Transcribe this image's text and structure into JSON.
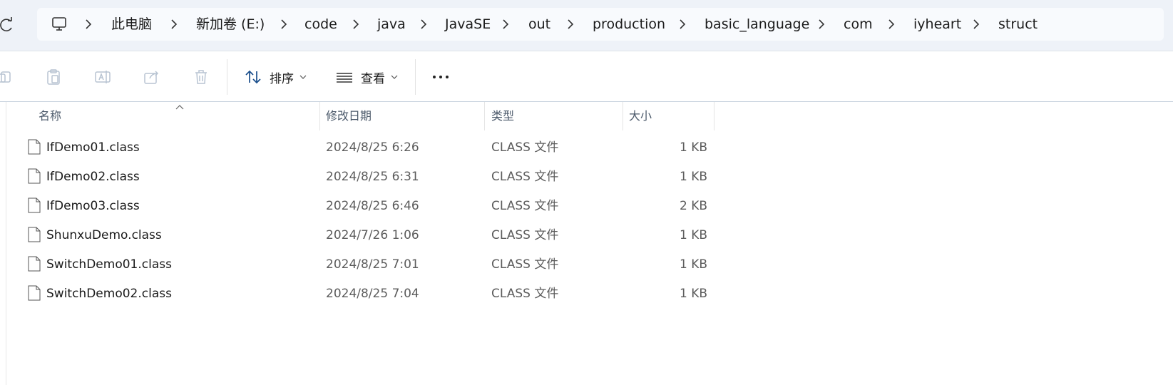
{
  "breadcrumbs": [
    "此电脑",
    "新加卷 (E:)",
    "code",
    "java",
    "JavaSE",
    "out",
    "production",
    "basic_language",
    "com",
    "iyheart",
    "struct"
  ],
  "toolbar": {
    "sort_label": "排序",
    "view_label": "查看"
  },
  "columns": {
    "name": "名称",
    "date": "修改日期",
    "type": "类型",
    "size": "大小"
  },
  "files": [
    {
      "name": "IfDemo01.class",
      "date": "2024/8/25 6:26",
      "type": "CLASS 文件",
      "size": "1 KB"
    },
    {
      "name": "IfDemo02.class",
      "date": "2024/8/25 6:31",
      "type": "CLASS 文件",
      "size": "1 KB"
    },
    {
      "name": "IfDemo03.class",
      "date": "2024/8/25 6:46",
      "type": "CLASS 文件",
      "size": "2 KB"
    },
    {
      "name": "ShunxuDemo.class",
      "date": "2024/7/26 1:06",
      "type": "CLASS 文件",
      "size": "1 KB"
    },
    {
      "name": "SwitchDemo01.class",
      "date": "2024/8/25 7:01",
      "type": "CLASS 文件",
      "size": "1 KB"
    },
    {
      "name": "SwitchDemo02.class",
      "date": "2024/8/25 7:04",
      "type": "CLASS 文件",
      "size": "1 KB"
    }
  ]
}
